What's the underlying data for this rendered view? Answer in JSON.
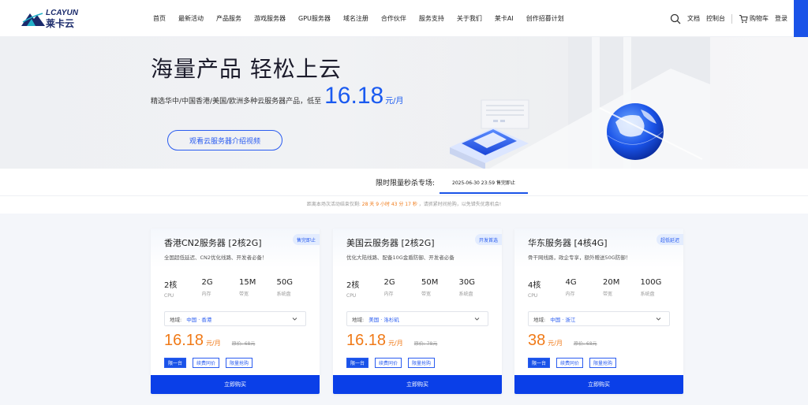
{
  "nav": {
    "logo_top": "LCAYUN",
    "logo_bottom": "莱卡云",
    "menu": [
      "首页",
      "最新活动",
      "产品服务",
      "游戏服务器",
      "GPU服务器",
      "域名注册",
      "合作伙伴",
      "服务支持",
      "关于我们",
      "莱卡AI",
      "创作招募计划"
    ],
    "docs": "文档",
    "console": "控制台",
    "cart": "购物车",
    "login": "登录"
  },
  "hero": {
    "title": "海量产品 轻松上云",
    "subtitle": "精选华中/中国香港/美国/欧洲多种云服务器产品，低至",
    "price": "16.18",
    "unit": "元/月",
    "video_button": "观看云服务器介绍视频"
  },
  "flash": {
    "label": "限时限量秒杀专场:",
    "tab": "2025-06-30 23:59 售完即止",
    "countdown_prefix": "距离本场次活动结束仅剩:",
    "countdown_value": "28 天 9 小时 43 分 17 秒",
    "countdown_suffix": "，请抓紧时间抢购，以免错失优惠机会!"
  },
  "cards": [
    {
      "title": "香港CN2服务器 [2核2G]",
      "badge": "售完即止",
      "desc": "全国超低延迟、CN2优化线路、开发者必备！",
      "specs": [
        {
          "value": "2核",
          "label": "CPU"
        },
        {
          "value": "2G",
          "label": "内存"
        },
        {
          "value": "15M",
          "label": "带宽"
        },
        {
          "value": "50G",
          "label": "系统盘"
        }
      ],
      "region_label": "地域:",
      "region_value": "中国 · 香港",
      "price": "16.18",
      "unit": "元/月",
      "old_price": "原价: 68元",
      "tags": [
        "限一台",
        "续费同价",
        "限量抢购"
      ],
      "buy": "立即购买"
    },
    {
      "title": "美国云服务器 [2核2G]",
      "badge": "开发首选",
      "desc": "优化大陆线路、配备10G金盾防御、开发者必备",
      "specs": [
        {
          "value": "2核",
          "label": "CPU"
        },
        {
          "value": "2G",
          "label": "内存"
        },
        {
          "value": "50M",
          "label": "带宽"
        },
        {
          "value": "30G",
          "label": "系统盘"
        }
      ],
      "region_label": "地域:",
      "region_value": "美国 · 洛杉矶",
      "price": "16.18",
      "unit": "元/月",
      "old_price": "原价: 78元",
      "tags": [
        "限一台",
        "续费同价",
        "限量抢购"
      ],
      "buy": "立即购买"
    },
    {
      "title": "华东服务器 [4核4G]",
      "badge": "超低延迟",
      "desc": "骨干网线路，政企专享，额外赠送50G防御！",
      "specs": [
        {
          "value": "4核",
          "label": "CPU"
        },
        {
          "value": "4G",
          "label": "内存"
        },
        {
          "value": "20M",
          "label": "带宽"
        },
        {
          "value": "100G",
          "label": "系统盘"
        }
      ],
      "region_label": "地域:",
      "region_value": "中国 · 浙江",
      "price": "38",
      "unit": "元/月",
      "old_price": "原价: 68元",
      "tags": [
        "限一台",
        "续费同价",
        "限量抢购"
      ],
      "buy": "立即购买"
    }
  ],
  "colors": {
    "brand_blue": "#1a53e8",
    "price_orange": "#f07a18"
  }
}
